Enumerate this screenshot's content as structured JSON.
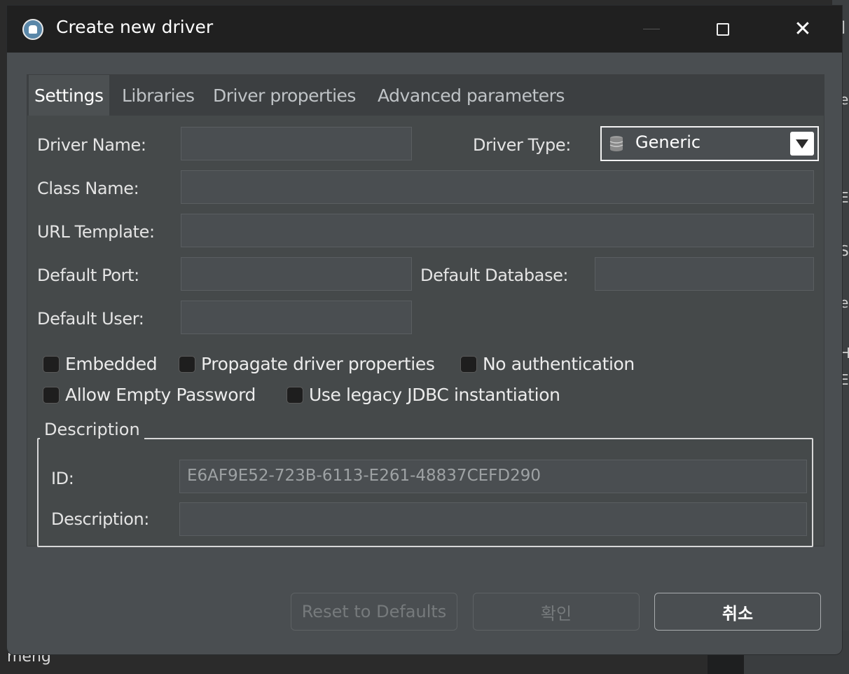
{
  "window": {
    "title": "Create new driver",
    "min_glyph": "",
    "close_glyph": "✕"
  },
  "background": {
    "bottom_text": "meng",
    "right_glyphs": [
      "]",
      "e",
      "E",
      "S",
      "e",
      "H",
      "E"
    ]
  },
  "tabs": [
    {
      "label": "Settings",
      "active": true
    },
    {
      "label": "Libraries",
      "active": false
    },
    {
      "label": "Driver properties",
      "active": false
    },
    {
      "label": "Advanced parameters",
      "active": false
    }
  ],
  "settings": {
    "driver_name_label": "Driver Name:",
    "driver_name_value": "",
    "driver_type_label": "Driver Type:",
    "driver_type_value": "Generic",
    "class_name_label": "Class Name:",
    "class_name_value": "",
    "url_template_label": "URL Template:",
    "url_template_value": "",
    "default_port_label": "Default Port:",
    "default_port_value": "",
    "default_database_label": "Default Database:",
    "default_database_value": "",
    "default_user_label": "Default User:",
    "default_user_value": ""
  },
  "options": [
    {
      "label": "Embedded",
      "checked": false
    },
    {
      "label": "Propagate driver properties",
      "checked": false
    },
    {
      "label": "No authentication",
      "checked": false
    },
    {
      "label": "Allow Empty Password",
      "checked": false
    },
    {
      "label": "Use legacy JDBC instantiation",
      "checked": false
    }
  ],
  "description_group": {
    "legend": "Description",
    "id_label": "ID:",
    "id_value": "E6AF9E52-723B-6113-E261-48837CEFD290",
    "description_label": "Description:",
    "description_value": ""
  },
  "buttons": {
    "reset_label": "Reset to Defaults",
    "ok_label": "확인",
    "cancel_label": "취소"
  },
  "colors": {
    "dialog_bg": "#4a4e51",
    "titlebar_bg": "#202020",
    "tabbar_bg": "#3c3f41",
    "active_tab_bg": "#4c5052"
  }
}
